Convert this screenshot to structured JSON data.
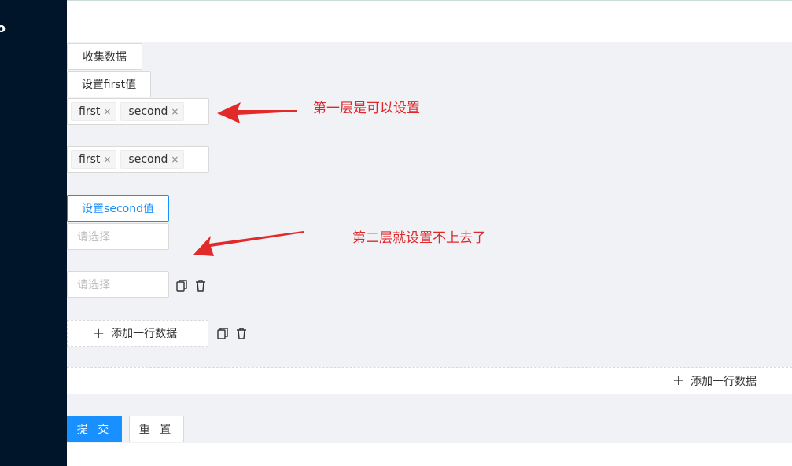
{
  "buttons": {
    "collect": "收集数据",
    "set_first": "设置first值",
    "set_second": "设置second值",
    "submit": "提 交",
    "reset": "重 置"
  },
  "tag_select_1": {
    "tags": [
      "first",
      "second"
    ],
    "remove_glyph": "×"
  },
  "tag_select_2": {
    "tags": [
      "first",
      "second"
    ],
    "remove_glyph": "×"
  },
  "select_placeholder_1": "请选择",
  "select_placeholder_2": "请选择",
  "add_row_inner": "添加一行数据",
  "add_row_outer": "添加一行数据",
  "annotations": {
    "first_layer": "第一层是可以设置",
    "second_layer": "第二层就设置不上去了"
  },
  "colors": {
    "primary": "#1890ff",
    "annotation": "#e0282c",
    "sidebar": "#001529"
  },
  "icons": [
    "copy-icon",
    "delete-icon",
    "plus-icon",
    "close-icon",
    "arrow-left-icon"
  ]
}
